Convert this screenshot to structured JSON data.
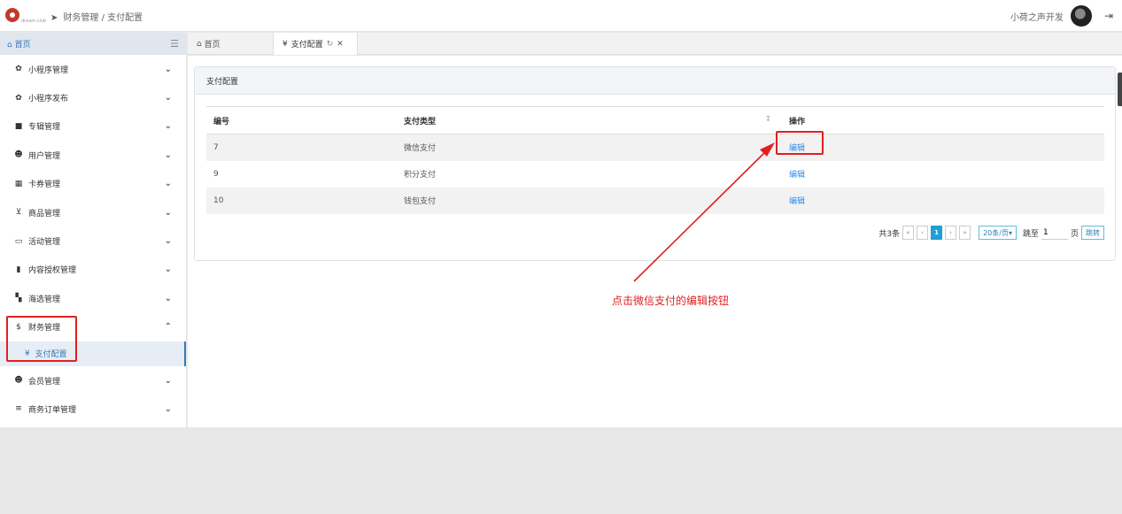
{
  "header": {
    "breadcrumb": "财务管理 / 支付配置",
    "user_name": "小荷之声开发",
    "logo_text": "",
    "logo_sub": "dream club"
  },
  "sidebar": {
    "home_label": "首页",
    "items": [
      {
        "label": "小程序管理",
        "icon": "gear-icon"
      },
      {
        "label": "小程序发布",
        "icon": "gear-icon"
      },
      {
        "label": "专辑管理",
        "icon": "video-icon"
      },
      {
        "label": "用户管理",
        "icon": "users-icon"
      },
      {
        "label": "卡券管理",
        "icon": "calculator-icon"
      },
      {
        "label": "商品管理",
        "icon": "cart-icon"
      },
      {
        "label": "活动管理",
        "icon": "monitor-icon"
      },
      {
        "label": "内容授权管理",
        "icon": "clipboard-icon"
      },
      {
        "label": "海选管理",
        "icon": "image-icon"
      },
      {
        "label": "财务管理",
        "icon": "dollar-icon"
      }
    ],
    "sub_item_label": "支付配置",
    "after_items": [
      {
        "label": "会员管理",
        "icon": "group-icon"
      },
      {
        "label": "商务订单管理",
        "icon": "list-icon"
      }
    ]
  },
  "tabs": {
    "home": "首页",
    "active": "支付配置"
  },
  "panel": {
    "title": "支付配置",
    "columns": [
      "编号",
      "支付类型",
      "操作"
    ],
    "rows": [
      {
        "id": "7",
        "type": "微信支付",
        "action": "编辑"
      },
      {
        "id": "9",
        "type": "积分支付",
        "action": "编辑"
      },
      {
        "id": "10",
        "type": "钱包支付",
        "action": "编辑"
      }
    ],
    "pager": {
      "total": "共3条",
      "current": "1",
      "page_size": "20条/页",
      "jump_label": "跳至",
      "jump_value": "1",
      "page_unit": "页",
      "go": "跳转"
    }
  },
  "annotation": "点击微信支付的编辑按钮",
  "colors": {
    "accent": "#337ab7",
    "highlight": "#e02020",
    "page_active": "#1e9fd6"
  }
}
